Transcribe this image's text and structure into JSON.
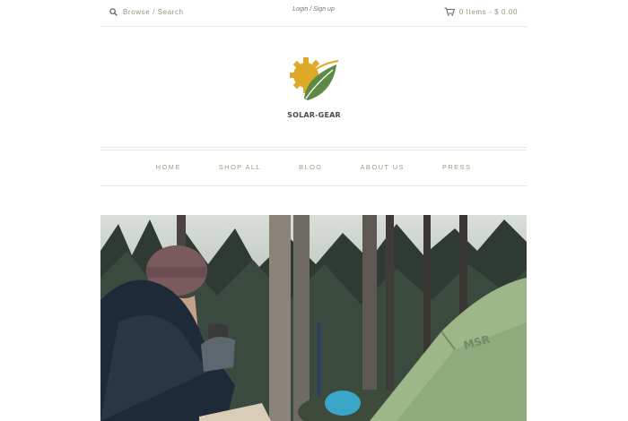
{
  "header": {
    "search_label": "Browse / Search",
    "login_label": "Login / Sign up",
    "cart_label": "0 Items - $ 0.00"
  },
  "logo": {
    "text": "SOLAR-GEAR"
  },
  "nav": {
    "items": [
      {
        "label": "HOME"
      },
      {
        "label": "SHOP ALL"
      },
      {
        "label": "BLOG"
      },
      {
        "label": "ABOUT US"
      },
      {
        "label": "PRESS"
      }
    ]
  },
  "hero": {
    "tent_brand": "MSR"
  },
  "colors": {
    "accent": "#a39a7e",
    "sun": "#dda927",
    "leaf": "#5f8a45",
    "tent": "#9db789"
  }
}
